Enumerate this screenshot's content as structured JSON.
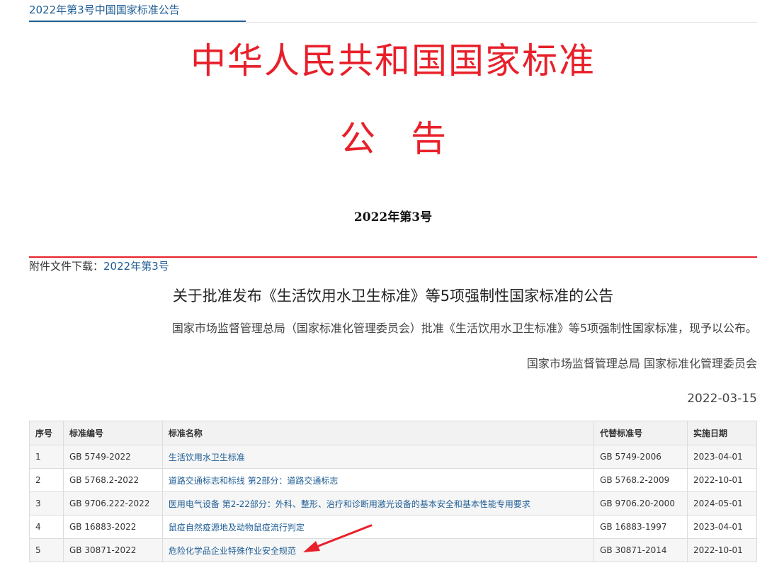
{
  "tab": {
    "title": "2022年第3号中国国家标准公告"
  },
  "header": {
    "main_title": "中华人民共和国国家标准",
    "notice_chars": [
      "公",
      "告"
    ],
    "issue": "2022年第3号"
  },
  "attachment": {
    "label": "附件文件下载：",
    "link": "2022年第3号"
  },
  "announcement": {
    "title": "关于批准发布《生活饮用水卫生标准》等5项强制性国家标准的公告",
    "body": "国家市场监督管理总局（国家标准化管理委员会）批准《生活饮用水卫生标准》等5项强制性国家标准，现予以公布。",
    "signature": "国家市场监督管理总局 国家标准化管理委员会",
    "date": "2022-03-15"
  },
  "table": {
    "headers": [
      "序号",
      "标准编号",
      "标准名称",
      "代替标准号",
      "实施日期"
    ],
    "rows": [
      [
        "1",
        "GB 5749-2022",
        "生活饮用水卫生标准",
        "GB 5749-2006",
        "2023-04-01"
      ],
      [
        "2",
        "GB 5768.2-2022",
        "道路交通标志和标线 第2部分：道路交通标志",
        "GB 5768.2-2009",
        "2022-10-01"
      ],
      [
        "3",
        "GB 9706.222-2022",
        "医用电气设备 第2-22部分：外科、整形、治疗和诊断用激光设备的基本安全和基本性能专用要求",
        "GB 9706.20-2000",
        "2024-05-01"
      ],
      [
        "4",
        "GB 16883-2022",
        "鼠疫自然疫源地及动物鼠疫流行判定",
        "GB 16883-1997",
        "2023-04-01"
      ],
      [
        "5",
        "GB 30871-2022",
        "危险化学品企业特殊作业安全规范",
        "GB 30871-2014",
        "2022-10-01"
      ]
    ]
  },
  "colors": {
    "red": "#e8202a",
    "link": "#1f5d95",
    "arrow": "#e8202a"
  }
}
